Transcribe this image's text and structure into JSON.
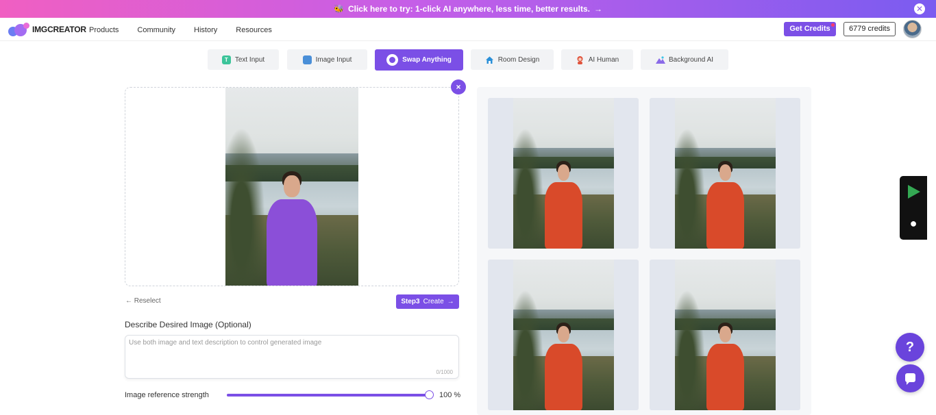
{
  "banner": {
    "emoji": "🐝",
    "text": "Click here to try: 1-click AI anywhere, less time, better results.",
    "arrow": "→",
    "close": "✕"
  },
  "header": {
    "logo_text": "IMGCREATOR",
    "nav": [
      "Products",
      "Community",
      "History",
      "Resources"
    ],
    "get_credits": "Get Credits",
    "credits": "6779 credits"
  },
  "tabs": [
    {
      "label": "Text Input",
      "icon": "T",
      "icon_color": "#3cc49a",
      "active": false
    },
    {
      "label": "Image Input",
      "icon": "",
      "icon_color": "#4a8fd8",
      "active": false
    },
    {
      "label": "Swap Anything",
      "icon": "",
      "icon_color": "#ffffff",
      "active": true
    },
    {
      "label": "Room Design",
      "icon": "",
      "icon_color": "#2a8fd8",
      "active": false
    },
    {
      "label": "AI Human",
      "icon": "",
      "icon_color": "#e0533c",
      "active": false
    },
    {
      "label": "Background AI",
      "icon": "",
      "icon_color": "#8a6ae8",
      "active": false
    }
  ],
  "editor": {
    "remove": "×",
    "reselect": "← Reselect",
    "create_step": "Step3",
    "create_label": "Create",
    "create_arrow": "→",
    "describe_label": "Describe Desired Image (Optional)",
    "describe_placeholder": "Use both image and text description to control generated image",
    "describe_count": "0/1000",
    "strength_label": "Image reference strength",
    "strength_value": "100 %",
    "strength_fraction": 1.0
  },
  "help": "?",
  "colors": {
    "accent": "#7b4fe6",
    "swap_mask": "#8b4fd8",
    "dress": "#d94a2a"
  }
}
